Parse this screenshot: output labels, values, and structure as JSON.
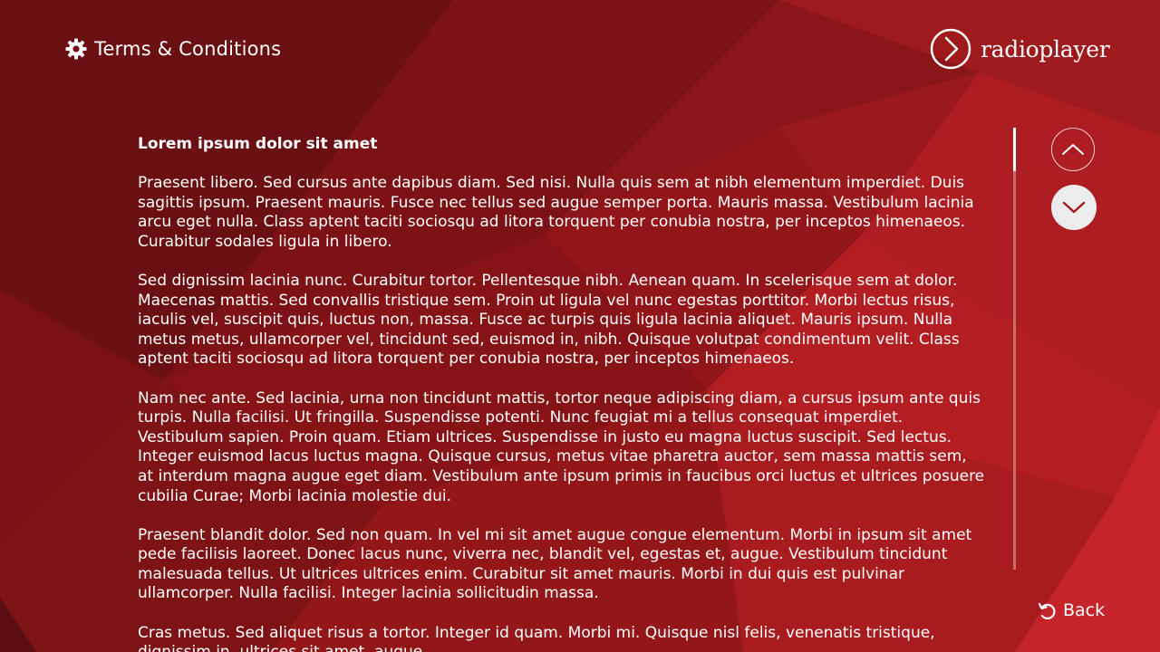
{
  "theme": {
    "background_dark": "#6d1013",
    "background_mid": "#8e1518",
    "background_light": "#c22226",
    "text": "#ffffff",
    "down_button_fill": "#ececec",
    "down_arrow_color": "#a01a1d"
  },
  "header": {
    "icon": "gear-icon",
    "title": "Terms & Conditions"
  },
  "brand": {
    "icon": "chevron-circle-icon",
    "name": "radioplayer"
  },
  "document": {
    "heading": "Lorem ipsum dolor sit amet",
    "paragraphs": [
      "Praesent libero. Sed cursus ante dapibus diam. Sed nisi. Nulla quis sem at nibh elementum imperdiet. Duis sagittis ipsum. Praesent mauris. Fusce nec tellus sed augue semper porta. Mauris massa. Vestibulum lacinia arcu eget nulla. Class aptent taciti sociosqu ad litora torquent per conubia nostra, per inceptos himenaeos. Curabitur sodales ligula in libero.",
      "Sed dignissim lacinia nunc. Curabitur tortor. Pellentesque nibh. Aenean quam. In scelerisque sem at dolor. Maecenas mattis. Sed convallis tristique sem. Proin ut ligula vel nunc egestas porttitor. Morbi lectus risus, iaculis vel, suscipit quis, luctus non, massa. Fusce ac turpis quis ligula lacinia aliquet. Mauris ipsum. Nulla metus metus, ullamcorper vel, tincidunt sed, euismod in, nibh. Quisque volutpat condimentum velit. Class aptent taciti sociosqu ad litora torquent per conubia nostra, per inceptos himenaeos.",
      "Nam nec ante. Sed lacinia, urna non tincidunt mattis, tortor neque adipiscing diam, a cursus ipsum ante quis turpis. Nulla facilisi. Ut fringilla. Suspendisse potenti. Nunc feugiat mi a tellus consequat imperdiet. Vestibulum sapien. Proin quam. Etiam ultrices. Suspendisse in justo eu magna luctus suscipit. Sed lectus. Integer euismod lacus luctus magna. Quisque cursus, metus vitae pharetra auctor, sem massa mattis sem, at interdum magna augue eget diam. Vestibulum ante ipsum primis in faucibus orci luctus et ultrices posuere cubilia Curae; Morbi lacinia molestie dui.",
      "Praesent blandit dolor. Sed non quam. In vel mi sit amet augue congue elementum. Morbi in ipsum sit amet pede facilisis laoreet. Donec lacus nunc, viverra nec, blandit vel, egestas et, augue. Vestibulum tincidunt malesuada tellus. Ut ultrices ultrices enim. Curabitur sit amet mauris. Morbi in dui quis est pulvinar ullamcorper. Nulla facilisi. Integer lacinia sollicitudin massa.",
      "Cras metus. Sed aliquet risus a tortor. Integer id quam. Morbi mi. Quisque nisl felis, venenatis tristique, dignissim in, ultrices sit amet, augue."
    ]
  },
  "scroll": {
    "up_icon": "chevron-up-icon",
    "down_icon": "chevron-down-icon",
    "position_fraction": 0.0
  },
  "back": {
    "icon": "undo-arrow-icon",
    "label": "Back"
  }
}
